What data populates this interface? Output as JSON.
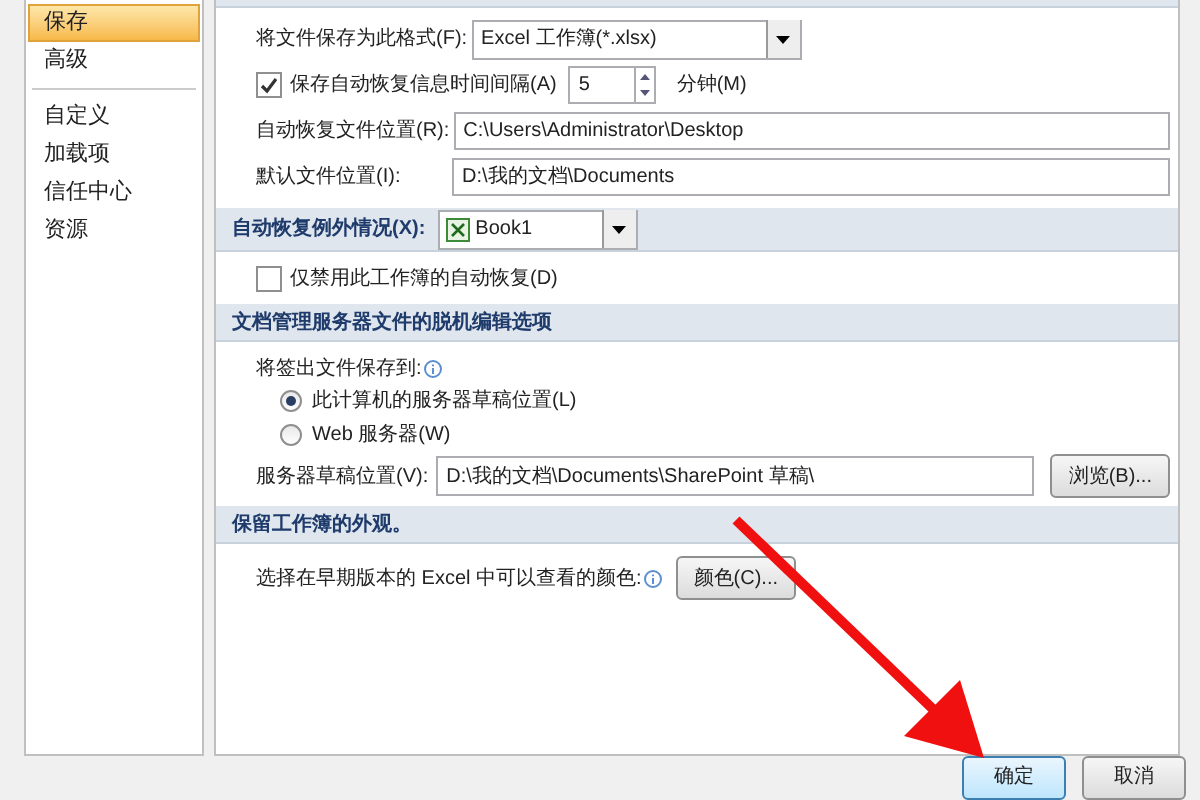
{
  "sidebar": {
    "items": [
      {
        "label": "保存",
        "selected": true
      },
      {
        "label": "高级",
        "selected": false
      },
      {
        "label": "自定义",
        "selected": false,
        "separator_before": true
      },
      {
        "label": "加载项",
        "selected": false
      },
      {
        "label": "信任中心",
        "selected": false
      },
      {
        "label": "资源",
        "selected": false
      }
    ]
  },
  "save_workbooks": {
    "format_label": "将文件保存为此格式(F):",
    "format_value": "Excel 工作簿(*.xlsx)",
    "autorecover_label": "保存自动恢复信息时间间隔(A)",
    "autorecover_checked": true,
    "interval_value": "5",
    "interval_unit": "分钟(M)",
    "autorecover_location_label": "自动恢复文件位置(R):",
    "autorecover_location_value": "C:\\Users\\Administrator\\Desktop",
    "default_location_label": "默认文件位置(I):",
    "default_location_value": "D:\\我的文档\\Documents"
  },
  "autorecover_exceptions": {
    "header": "自动恢复例外情况(X):",
    "workbook": "Book1",
    "disable_label": "仅禁用此工作簿的自动恢复(D)",
    "disable_checked": false
  },
  "offline_editing": {
    "header": "文档管理服务器文件的脱机编辑选项",
    "save_to_label": "将签出文件保存到:",
    "options": [
      {
        "label": "此计算机的服务器草稿位置(L)",
        "selected": true
      },
      {
        "label": "Web 服务器(W)",
        "selected": false
      }
    ],
    "drafts_label": "服务器草稿位置(V):",
    "drafts_value": "D:\\我的文档\\Documents\\SharePoint 草稿\\",
    "browse_button": "浏览(B)..."
  },
  "appearance": {
    "header": "保留工作簿的外观。",
    "colors_label": "选择在早期版本的 Excel 中可以查看的颜色:",
    "colors_button": "颜色(C)..."
  },
  "buttons": [
    {
      "label": "确定",
      "default": true
    },
    {
      "label": "取消",
      "default": false
    }
  ]
}
